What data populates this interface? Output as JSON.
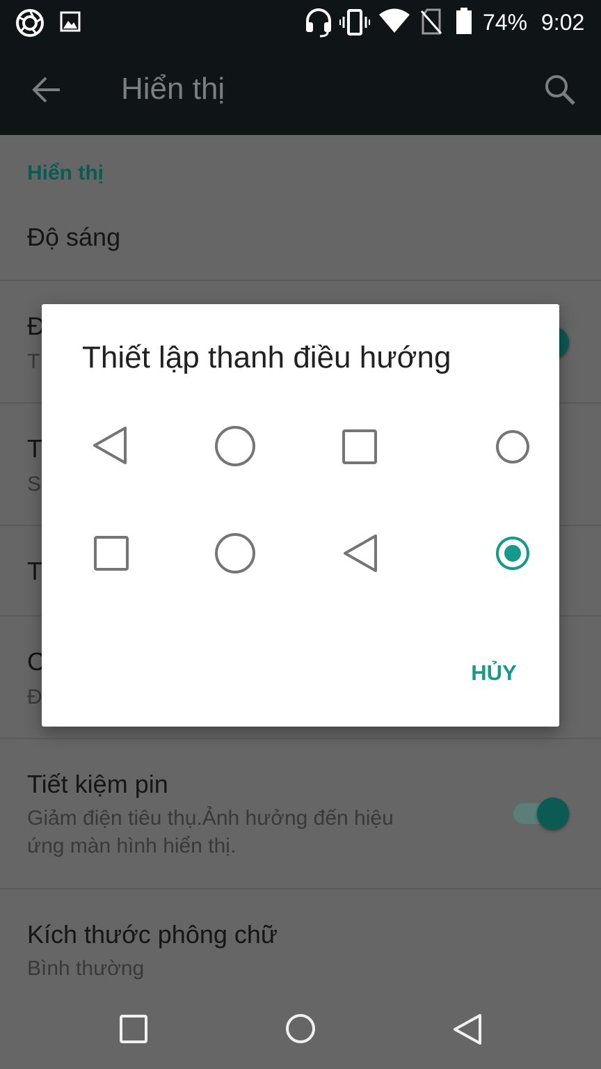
{
  "status_bar": {
    "battery_percent": "74%",
    "time": "9:02",
    "icons": [
      "camera-shutter-icon",
      "image-icon",
      "headset-icon",
      "vibrate-icon",
      "wifi-icon",
      "no-sim-icon",
      "battery-icon"
    ]
  },
  "toolbar": {
    "title": "Hiển thị",
    "back_icon": "arrow-back-icon",
    "search_icon": "search-icon"
  },
  "settings": {
    "section_header": "Hiển thị",
    "items": [
      {
        "title": "Độ sáng"
      },
      {
        "title": "Đ",
        "subtitle": "T",
        "toggle_on": true
      },
      {
        "title": "T",
        "subtitle": "S"
      },
      {
        "title": "T"
      },
      {
        "title": "C",
        "subtitle": "Đ"
      },
      {
        "title": "Tiết kiệm pin",
        "subtitle_line1": "Giảm điện tiêu thụ.Ảnh hưởng đến hiệu",
        "subtitle_line2": "ứng màn hình hiển thị.",
        "toggle_on": true
      },
      {
        "title": "Kích thước phông chữ",
        "subtitle": "Bình thường"
      }
    ]
  },
  "dialog": {
    "title": "Thiết lập thanh điều hướng",
    "options": [
      {
        "icons": [
          "back-triangle-icon",
          "home-circle-icon",
          "recents-square-icon"
        ],
        "selected": false
      },
      {
        "icons": [
          "recents-square-icon",
          "home-circle-icon",
          "back-triangle-icon"
        ],
        "selected": true
      }
    ],
    "cancel_label": "HỦY"
  },
  "colors": {
    "accent": "#159a8c",
    "status_bar_bg": "#0f1416",
    "scrim_bg": "#666666"
  },
  "nav_bar": {
    "icons": [
      "recents-square-icon",
      "home-circle-icon",
      "back-triangle-icon"
    ]
  }
}
